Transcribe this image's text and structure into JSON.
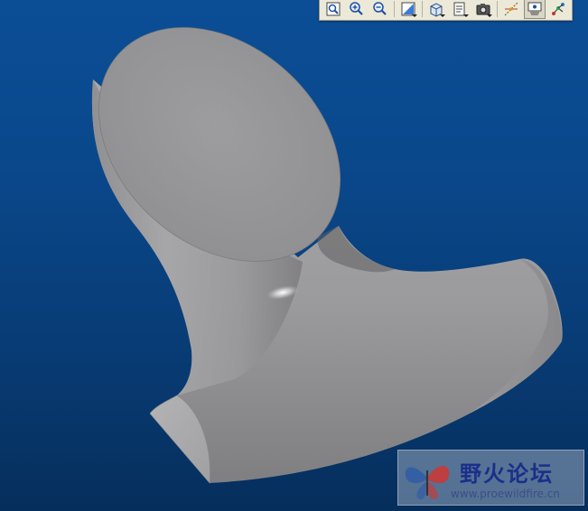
{
  "viewport": {
    "background_top": "#0b4e96",
    "background_bottom": "#062e5c",
    "model_color": "#a4a4a6"
  },
  "toolbar": {
    "buttons": [
      {
        "icon": "refit-icon"
      },
      {
        "icon": "zoom-in-icon"
      },
      {
        "icon": "zoom-out-icon"
      },
      {
        "icon": "repaint-icon"
      },
      {
        "icon": "display-style-icon"
      },
      {
        "icon": "saved-views-icon"
      },
      {
        "icon": "view-manager-icon"
      },
      {
        "icon": "datum-display-icon"
      },
      {
        "icon": "layers-icon"
      },
      {
        "icon": "spin-center-icon"
      }
    ],
    "active_index": 8
  },
  "watermark": {
    "title": "野火论坛",
    "url": "www.proewildfire.cn"
  }
}
